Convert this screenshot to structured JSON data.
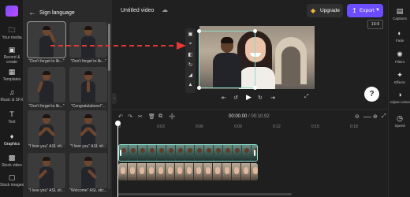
{
  "app": {
    "document_title": "Untitled video"
  },
  "left_rail": {
    "items": [
      {
        "label": "Your media",
        "icon": "folder-icon"
      },
      {
        "label": "Record & create",
        "icon": "camera-icon"
      },
      {
        "label": "Templates",
        "icon": "templates-icon"
      },
      {
        "label": "Music & SFX",
        "icon": "music-icon"
      },
      {
        "label": "Text",
        "icon": "text-icon"
      },
      {
        "label": "Graphics",
        "icon": "shapes-icon",
        "active": true
      },
      {
        "label": "Stock video",
        "icon": "film-icon"
      },
      {
        "label": "Stock images",
        "icon": "image-icon"
      }
    ]
  },
  "library": {
    "title": "Sign language",
    "items": [
      {
        "label": "\"Don't forget to lik...\""
      },
      {
        "label": "\"Don't forget to lik...\""
      },
      {
        "label": "\"Don't forget to lik...\""
      },
      {
        "label": "\"Congratulations!\"..."
      },
      {
        "label": "\"I love you\" ASL sti..."
      },
      {
        "label": "\"I love you\" ASL sti..."
      },
      {
        "label": "\"I love you\" ASL sti..."
      },
      {
        "label": "\"Welcome\" ASL stic..."
      }
    ]
  },
  "topbar": {
    "upgrade_label": "Upgrade",
    "export_label": "Export"
  },
  "preview": {
    "aspect_ratio": "16:9"
  },
  "right_rail": {
    "items": [
      {
        "label": "Captions",
        "icon": "captions-icon"
      },
      {
        "label": "Fade",
        "icon": "fade-icon"
      },
      {
        "label": "Filters",
        "icon": "filters-icon"
      },
      {
        "label": "Effects",
        "icon": "effects-icon"
      },
      {
        "label": "Adjust colors",
        "icon": "adjust-colors-icon"
      },
      {
        "label": "Speed",
        "icon": "speed-icon"
      }
    ]
  },
  "timeline": {
    "current_time": "00:00.00",
    "duration": "/ 00:10.92",
    "ruler": [
      "0",
      "0:03",
      "0:06",
      "0:09",
      "0:12",
      "0:15",
      "0:18",
      "0:21",
      "0:24"
    ]
  },
  "colors": {
    "accent": "#6b4cff",
    "selection": "#8edcc7",
    "annotation_arrow": "#e53935"
  }
}
